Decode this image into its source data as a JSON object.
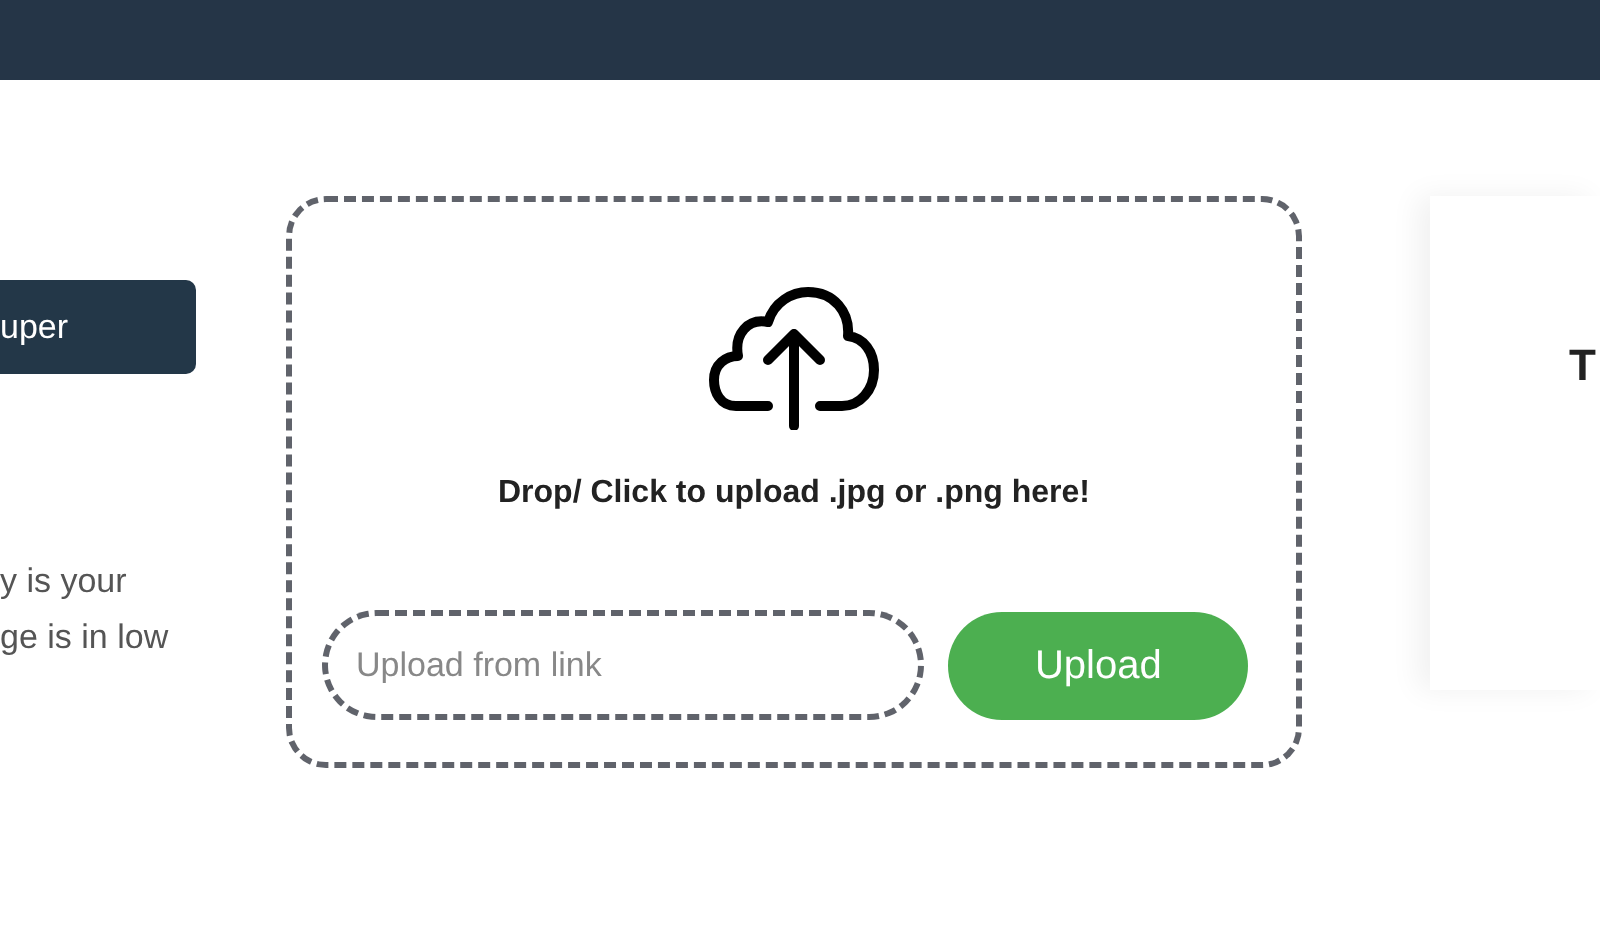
{
  "left_panel": {
    "button": "uper",
    "text_lines": [
      "y is your",
      "ge is in low"
    ]
  },
  "dropzone": {
    "prompt": "Drop/ Click to upload .jpg or .png here!",
    "link_field": {
      "placeholder": "Upload from link"
    },
    "upload_button": "Upload"
  },
  "right_card": {
    "heading": "T"
  }
}
